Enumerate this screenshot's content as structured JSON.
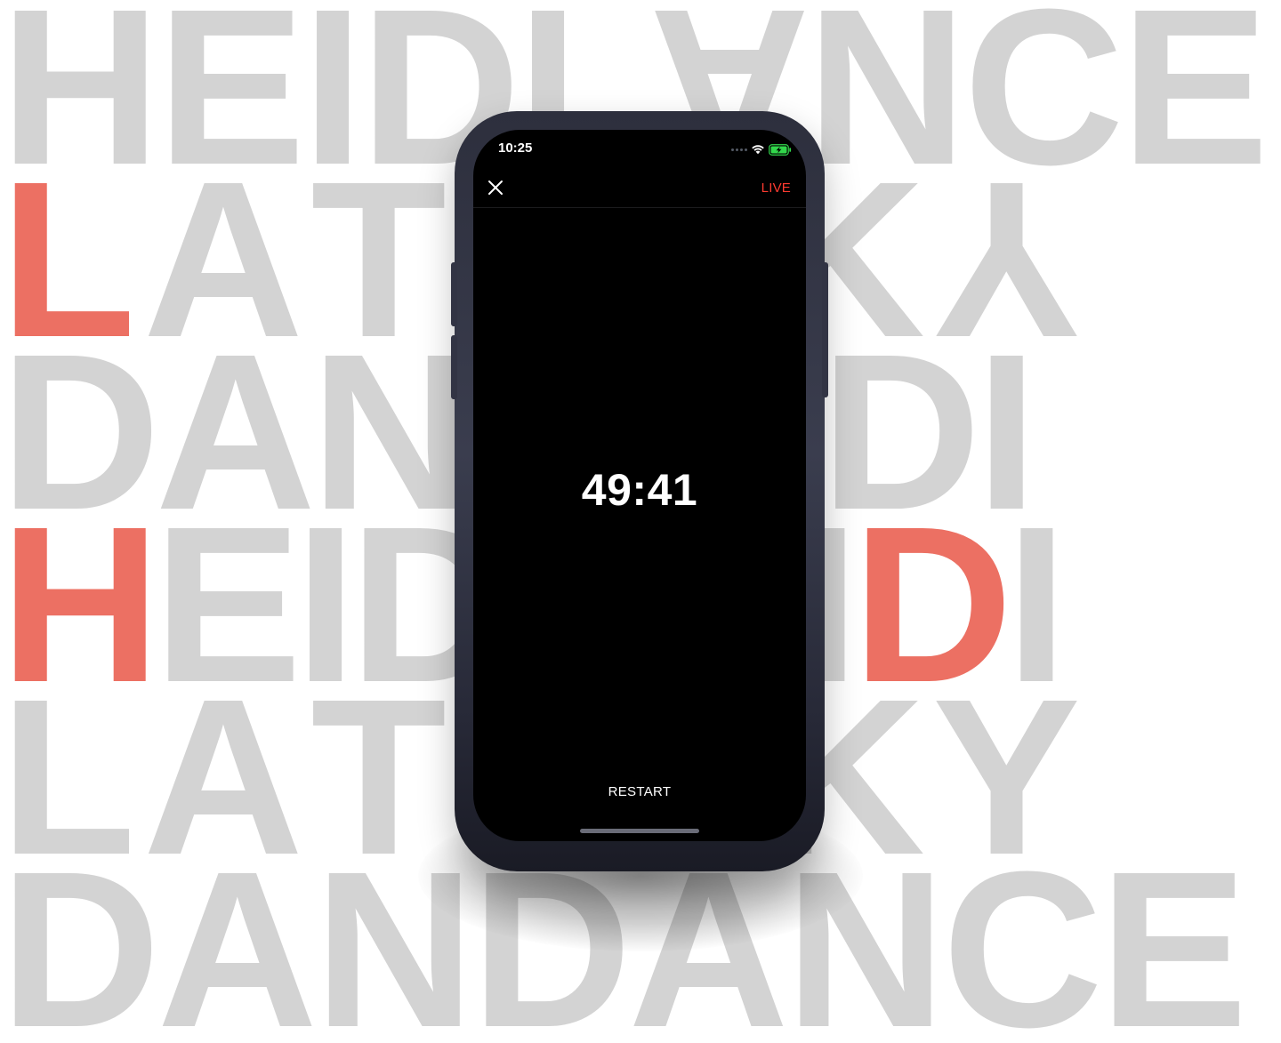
{
  "background": {
    "text_color": "#d3d3d3",
    "accent_color": "#ec7063",
    "rows": [
      {
        "chars": [
          {
            "c": "H"
          },
          {
            "c": "E"
          },
          {
            "c": "I"
          },
          {
            "c": "D"
          },
          {
            "c": "L"
          },
          {
            "c": "A",
            "flip": "v"
          },
          {
            "c": "N"
          },
          {
            "c": "C"
          },
          {
            "c": "E"
          }
        ]
      },
      {
        "chars": [
          {
            "c": "L",
            "accent": true
          },
          {
            "c": "A"
          },
          {
            "c": "T"
          },
          {
            "c": "S"
          },
          {
            "c": "S",
            "flip": "v"
          },
          {
            "c": "K"
          },
          {
            "c": "Y",
            "flip": "v"
          }
        ]
      },
      {
        "chars": [
          {
            "c": "D"
          },
          {
            "c": "A"
          },
          {
            "c": "N"
          },
          {
            "c": "H"
          },
          {
            "c": "E"
          },
          {
            "c": "I"
          },
          {
            "c": "D"
          },
          {
            "c": "I"
          }
        ]
      },
      {
        "chars": [
          {
            "c": "H",
            "accent": true
          },
          {
            "c": "E"
          },
          {
            "c": "I"
          },
          {
            "c": "D"
          },
          {
            "c": "H"
          },
          {
            "c": "E"
          },
          {
            "c": "I"
          },
          {
            "c": "D",
            "accent": true
          },
          {
            "c": "I"
          }
        ]
      },
      {
        "chars": [
          {
            "c": "L"
          },
          {
            "c": "A"
          },
          {
            "c": "T"
          },
          {
            "c": "S"
          },
          {
            "c": "S"
          },
          {
            "c": "K"
          },
          {
            "c": "Y"
          }
        ]
      },
      {
        "chars": [
          {
            "c": "D"
          },
          {
            "c": "A"
          },
          {
            "c": "N"
          },
          {
            "c": "D"
          },
          {
            "c": "A"
          },
          {
            "c": "N"
          },
          {
            "c": "C"
          },
          {
            "c": "E"
          }
        ]
      }
    ]
  },
  "status_bar": {
    "time": "10:25",
    "icons": [
      "cellular-dots-icon",
      "wifi-icon",
      "battery-charging-icon"
    ],
    "battery_color": "#32d74b"
  },
  "nav": {
    "close_icon": "close-icon",
    "live_label": "LIVE",
    "live_color": "#ff3b30"
  },
  "timer": {
    "value": "49:41"
  },
  "controls": {
    "restart_label": "RESTART"
  },
  "phone": {
    "frame_color": "#2d2f3d",
    "screen_color": "#000000"
  }
}
